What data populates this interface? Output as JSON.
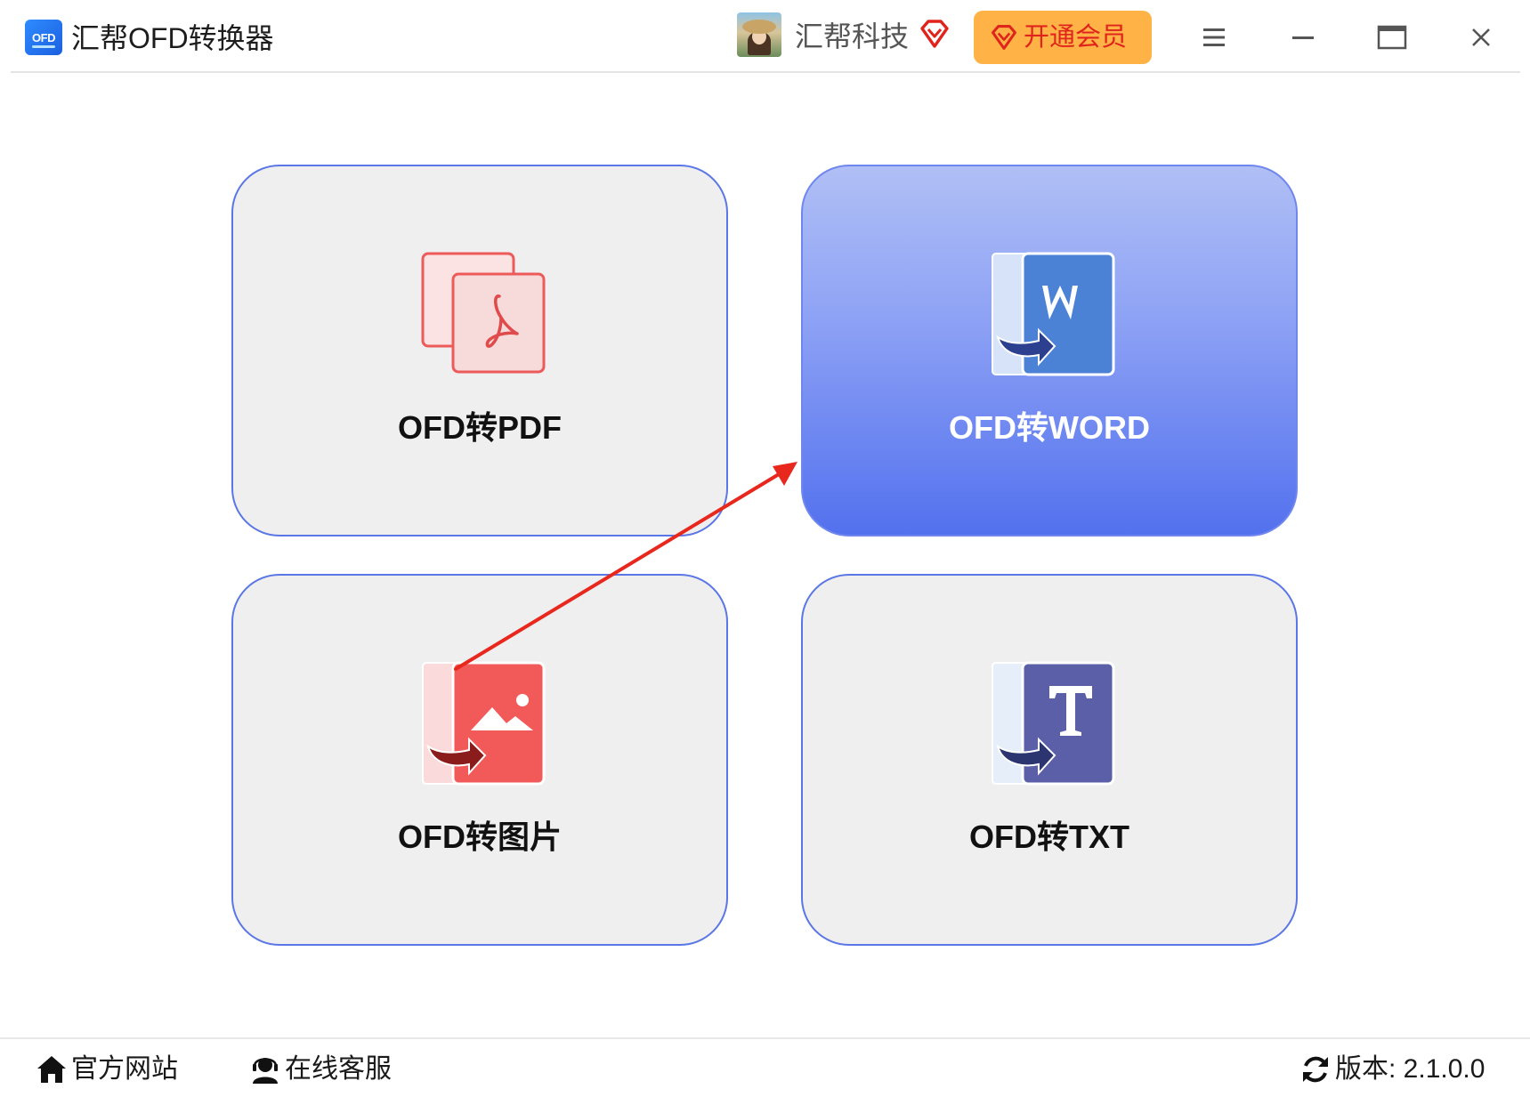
{
  "window": {
    "logo_text": "OFD",
    "title": "汇帮OFD转换器"
  },
  "account": {
    "user_name": "汇帮科技",
    "vip_button_label": "开通会员",
    "accent_color": "#e0241b",
    "vip_button_color": "#ffb347"
  },
  "window_controls": [
    "menu-icon",
    "minimize-icon",
    "maximize-icon",
    "close-icon"
  ],
  "cards": [
    {
      "label": "OFD转PDF",
      "icon": "pdf-document-icon",
      "active": false
    },
    {
      "label": "OFD转WORD",
      "icon": "word-document-icon",
      "active": true
    },
    {
      "label": "OFD转图片",
      "icon": "image-document-icon",
      "active": false
    },
    {
      "label": "OFD转TXT",
      "icon": "txt-document-icon",
      "active": false
    }
  ],
  "footer": {
    "website_label": "官方网站",
    "service_label": "在线客服",
    "version_label": "版本: 2.1.0.0"
  },
  "colors": {
    "card_border": "#5b76e6",
    "active_gradient_top": "#b0bff5",
    "active_gradient_bottom": "#5371ee",
    "annotation_arrow": "#e8271d"
  }
}
